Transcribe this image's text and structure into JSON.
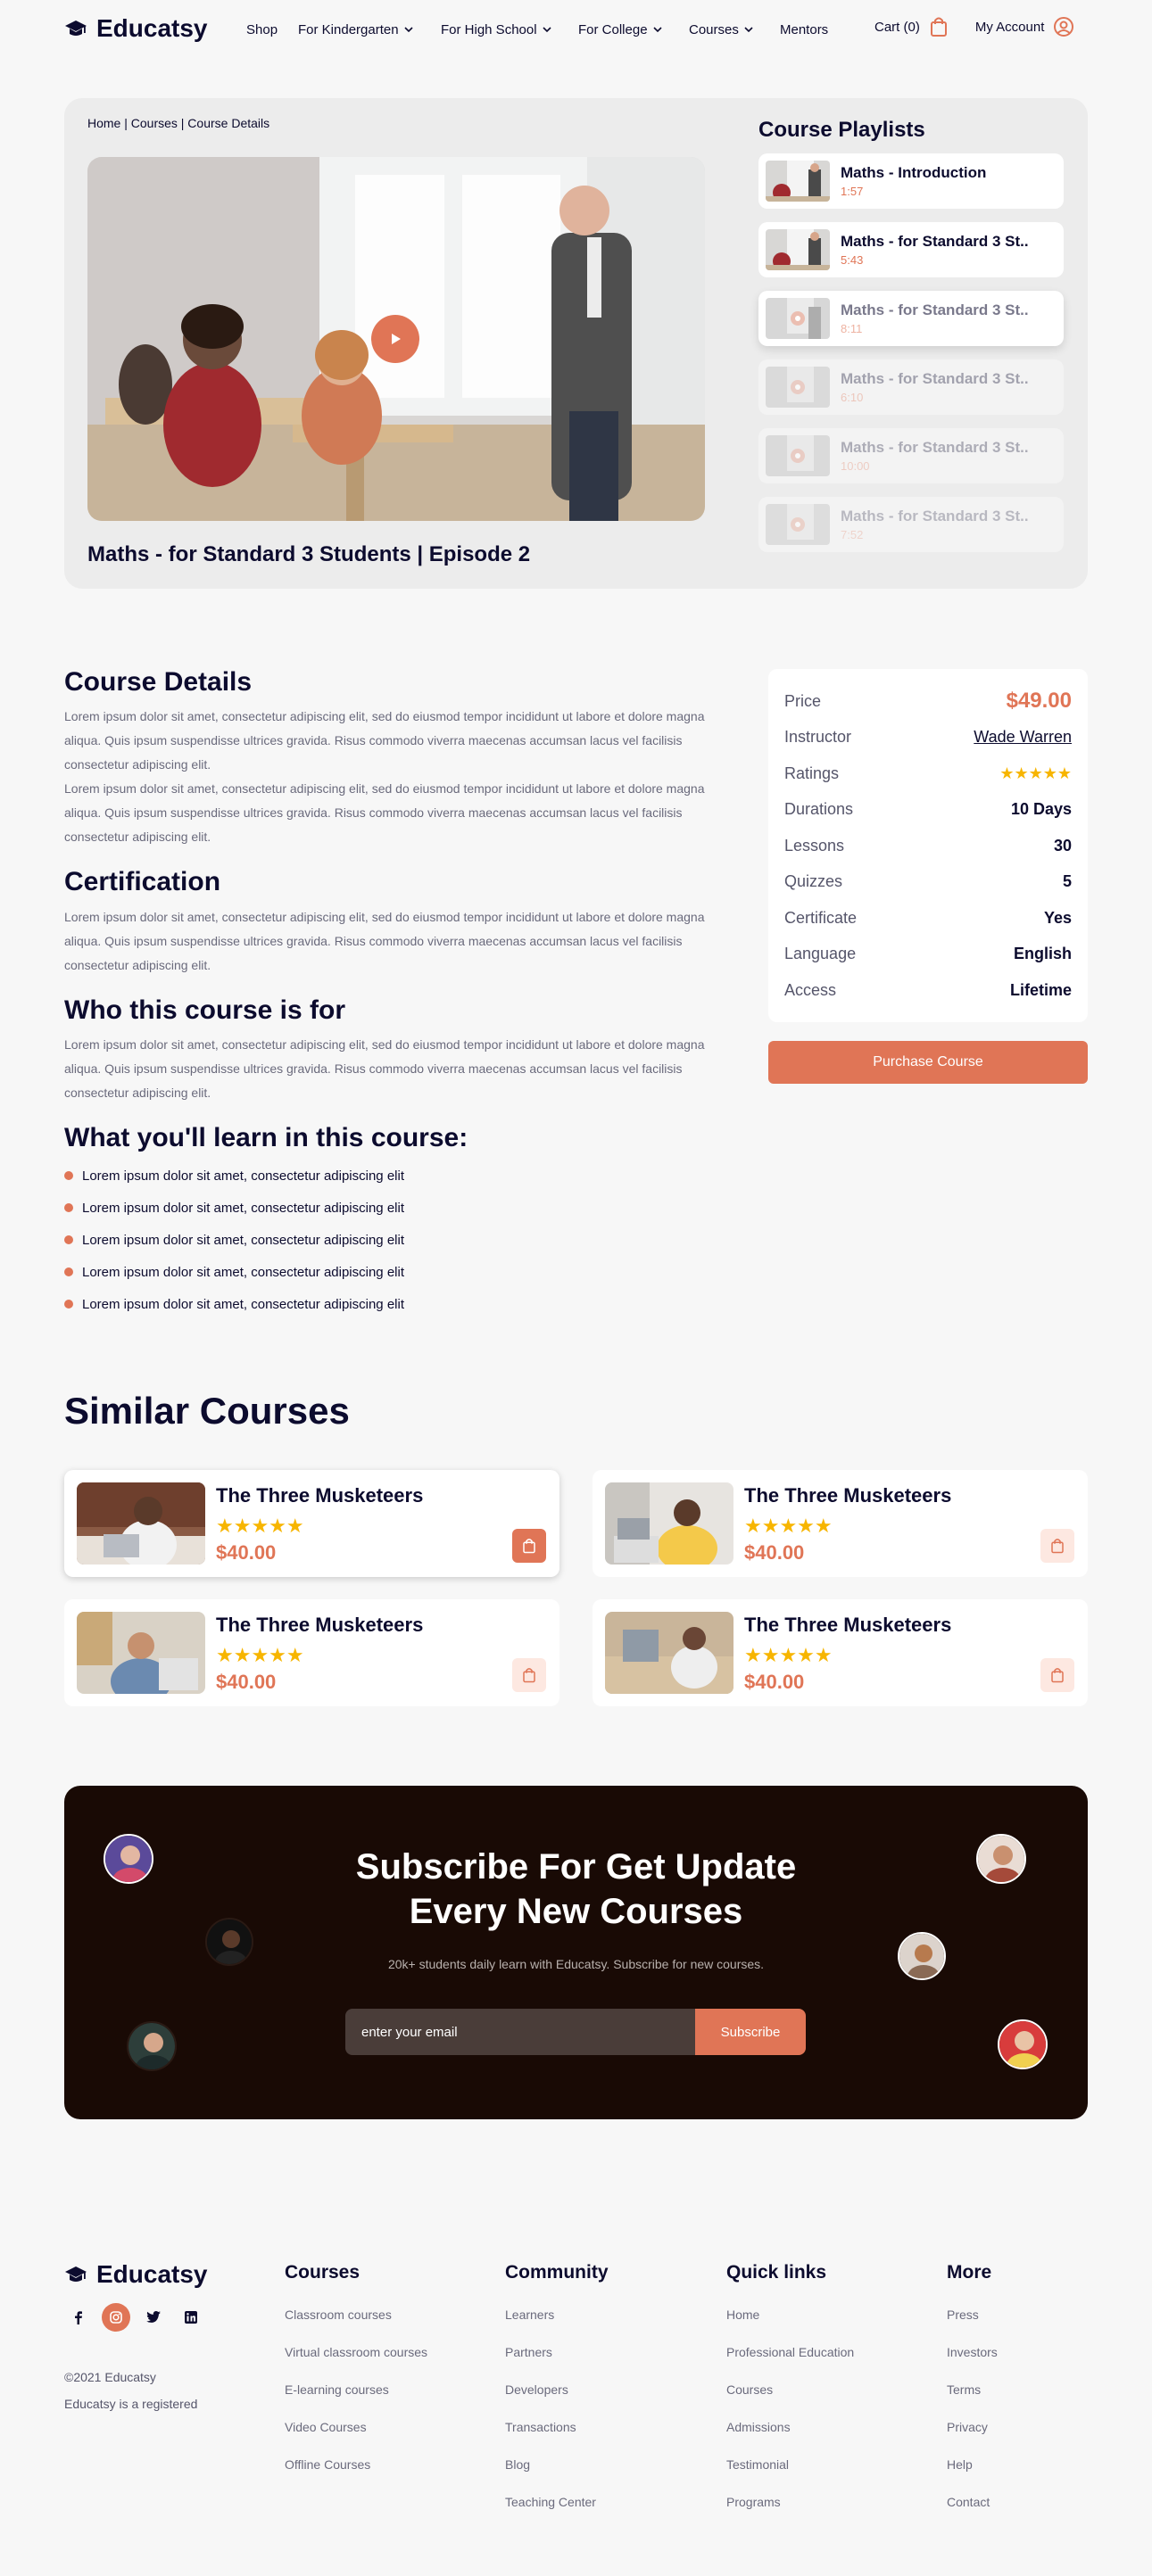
{
  "brand": "Educatsy",
  "nav": {
    "items": [
      "Shop",
      "For Kindergarten",
      "For High School",
      "For College",
      "Courses",
      "Mentors"
    ],
    "cart": "Cart (0)",
    "account": "My Account"
  },
  "hero": {
    "breadcrumb": "Home | Courses | Course Details",
    "video_title": "Maths - for Standard 3 Students | Episode 2",
    "playlist_title": "Course Playlists",
    "playlist": [
      {
        "name": "Maths - Introduction",
        "time": "1:57"
      },
      {
        "name": "Maths - for Standard 3 St..",
        "time": "5:43"
      },
      {
        "name": "Maths - for Standard 3 St..",
        "time": "8:11"
      },
      {
        "name": "Maths - for Standard 3 St..",
        "time": "6:10"
      },
      {
        "name": "Maths - for Standard 3 St..",
        "time": "10:00"
      },
      {
        "name": "Maths - for Standard 3 St..",
        "time": "7:52"
      }
    ]
  },
  "details": {
    "course_details_title": "Course Details",
    "course_details_p1": "Lorem ipsum dolor sit amet, consectetur adipiscing elit, sed do eiusmod tempor incididunt ut labore et dolore magna aliqua. Quis ipsum suspendisse ultrices gravida. Risus commodo viverra maecenas accumsan lacus vel facilisis consectetur adipiscing elit.",
    "course_details_p2": "Lorem ipsum dolor sit amet, consectetur adipiscing elit, sed do eiusmod tempor incididunt ut labore et dolore magna aliqua. Quis ipsum suspendisse ultrices gravida. Risus commodo viverra maecenas accumsan lacus vel facilisis consectetur adipiscing elit.",
    "certification_title": "Certification",
    "certification_p": "Lorem ipsum dolor sit amet, consectetur adipiscing elit, sed do eiusmod tempor incididunt ut labore et dolore magna aliqua. Quis ipsum suspendisse ultrices gravida. Risus commodo viverra maecenas accumsan lacus vel facilisis consectetur adipiscing elit.",
    "who_title": "Who this course is for",
    "who_p": "Lorem ipsum dolor sit amet, consectetur adipiscing elit, sed do eiusmod tempor incididunt ut labore et dolore magna aliqua. Quis ipsum suspendisse ultrices gravida. Risus commodo viverra maecenas accumsan lacus vel facilisis consectetur adipiscing elit.",
    "learn_title": "What you'll learn in this course:",
    "learn_items": [
      "Lorem ipsum dolor sit amet, consectetur adipiscing elit",
      "Lorem ipsum dolor sit amet, consectetur adipiscing elit",
      "Lorem ipsum dolor sit amet, consectetur adipiscing elit",
      "Lorem ipsum dolor sit amet, consectetur adipiscing elit",
      "Lorem ipsum dolor sit amet, consectetur adipiscing elit"
    ]
  },
  "info": {
    "price_label": "Price",
    "price": "$49.00",
    "instructor_label": "Instructor",
    "instructor": "Wade Warren",
    "ratings_label": "Ratings",
    "ratings_stars": "★★★★★",
    "rating_value": 5,
    "durations_label": "Durations",
    "durations": "10 Days",
    "lessons_label": "Lessons",
    "lessons": "30",
    "quizzes_label": "Quizzes",
    "quizzes": "5",
    "certificate_label": "Certificate",
    "certificate": "Yes",
    "language_label": "Language",
    "language": "English",
    "access_label": "Access",
    "access": "Lifetime",
    "purchase_label": "Purchase Course"
  },
  "similar": {
    "title": "Similar Courses",
    "courses": [
      {
        "name": "The Three Musketeers",
        "stars": "★★★★★",
        "price": "$40.00"
      },
      {
        "name": "The Three Musketeers",
        "stars": "★★★★★",
        "price": "$40.00"
      },
      {
        "name": "The Three Musketeers",
        "stars": "★★★★★",
        "price": "$40.00"
      },
      {
        "name": "The Three Musketeers",
        "stars": "★★★★★",
        "price": "$40.00"
      }
    ]
  },
  "subscribe": {
    "title_line1": "Subscribe For Get Update",
    "title_line2": "Every New Courses",
    "desc": "20k+ students daily learn with Educatsy. Subscribe for new courses.",
    "placeholder": "enter your email",
    "button": "Subscribe"
  },
  "footer": {
    "brand": "Educatsy",
    "copyright": "©2021 Educatsy",
    "registered": "Educatsy is a registered",
    "columns": [
      {
        "title": "Courses",
        "links": [
          "Classroom courses",
          "Virtual classroom courses",
          "E-learning courses",
          "Video Courses",
          "Offline Courses"
        ]
      },
      {
        "title": "Community",
        "links": [
          "Learners",
          "Partners",
          "Developers",
          "Transactions",
          "Blog",
          "Teaching Center"
        ]
      },
      {
        "title": "Quick links",
        "links": [
          "Home",
          "Professional Education",
          "Courses",
          "Admissions",
          "Testimonial",
          "Programs"
        ]
      },
      {
        "title": "More",
        "links": [
          "Press",
          "Investors",
          "Terms",
          "Privacy",
          "Help",
          "Contact"
        ]
      }
    ]
  },
  "colors": {
    "accent": "#e07556",
    "navy": "#0c0b2e",
    "dark": "#190a05",
    "star": "#f7b500"
  }
}
